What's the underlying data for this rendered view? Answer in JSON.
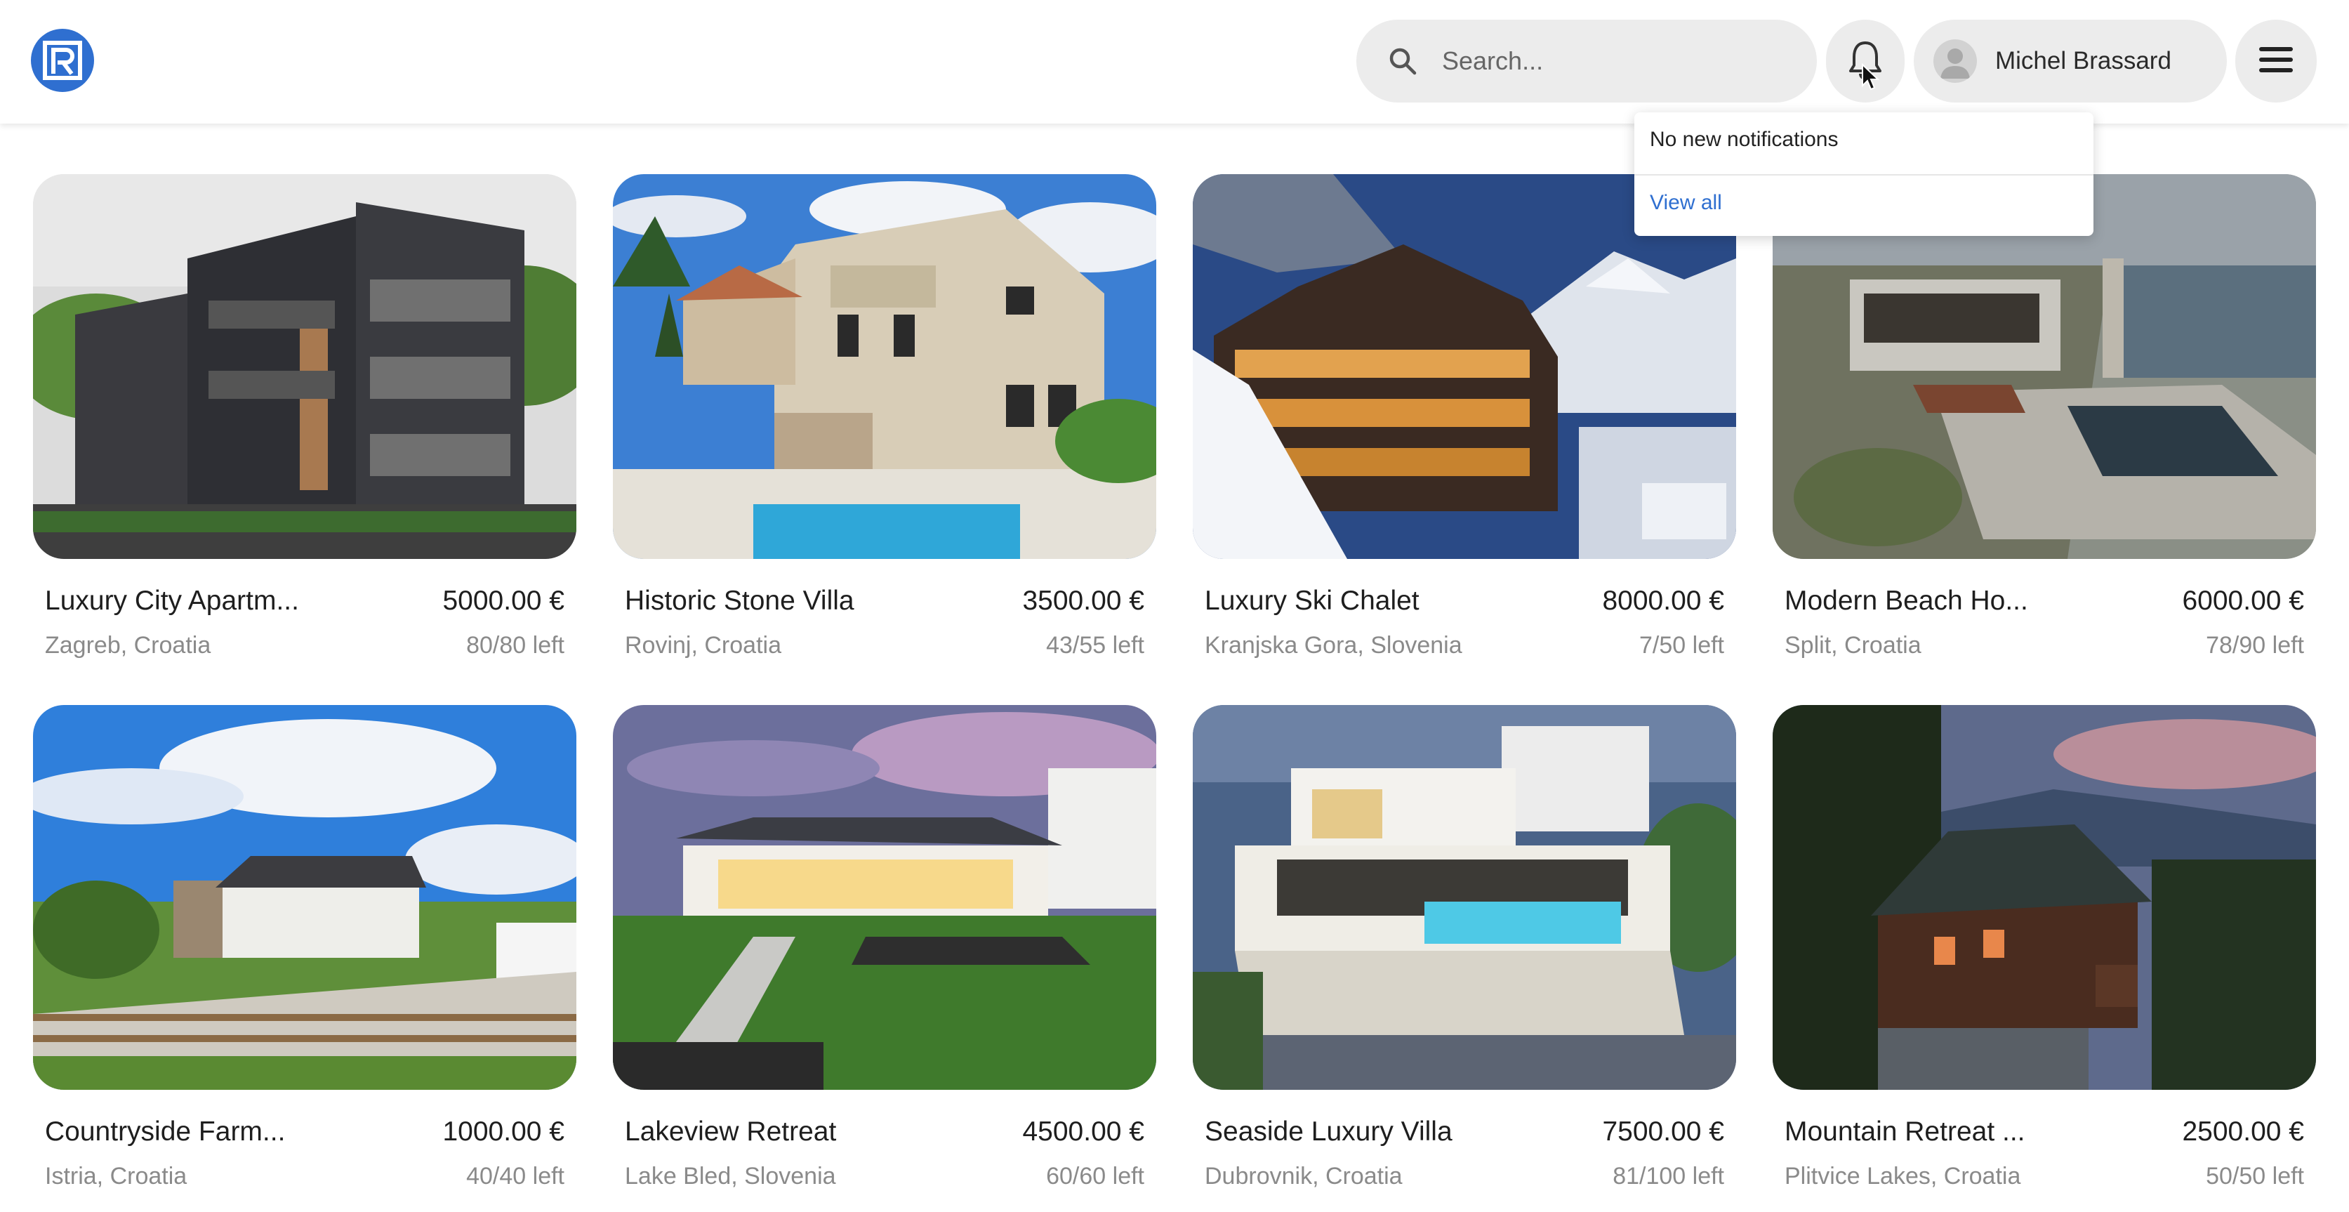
{
  "header": {
    "search_placeholder": "Search...",
    "user_name": "Michel Brassard"
  },
  "notifications": {
    "message": "No new notifications",
    "view_all": "View all"
  },
  "colors": {
    "accent": "#2f6fd0",
    "pill_bg": "#ececec",
    "muted_text": "#8a8a8a"
  },
  "listings": [
    {
      "title": "Luxury City Apartm...",
      "price": "5000.00 €",
      "location": "Zagreb, Croatia",
      "availability": "80/80 left"
    },
    {
      "title": "Historic Stone Villa",
      "price": "3500.00 €",
      "location": "Rovinj, Croatia",
      "availability": "43/55 left"
    },
    {
      "title": "Luxury Ski Chalet",
      "price": "8000.00 €",
      "location": "Kranjska Gora, Slovenia",
      "availability": "7/50 left"
    },
    {
      "title": "Modern Beach Ho...",
      "price": "6000.00 €",
      "location": "Split, Croatia",
      "availability": "78/90 left"
    },
    {
      "title": "Countryside Farm...",
      "price": "1000.00 €",
      "location": "Istria, Croatia",
      "availability": "40/40 left"
    },
    {
      "title": "Lakeview Retreat",
      "price": "4500.00 €",
      "location": "Lake Bled, Slovenia",
      "availability": "60/60 left"
    },
    {
      "title": "Seaside Luxury Villa",
      "price": "7500.00 €",
      "location": "Dubrovnik, Croatia",
      "availability": "81/100 left"
    },
    {
      "title": "Mountain Retreat ...",
      "price": "2500.00 €",
      "location": "Plitvice Lakes, Croatia",
      "availability": "50/50 left"
    }
  ]
}
